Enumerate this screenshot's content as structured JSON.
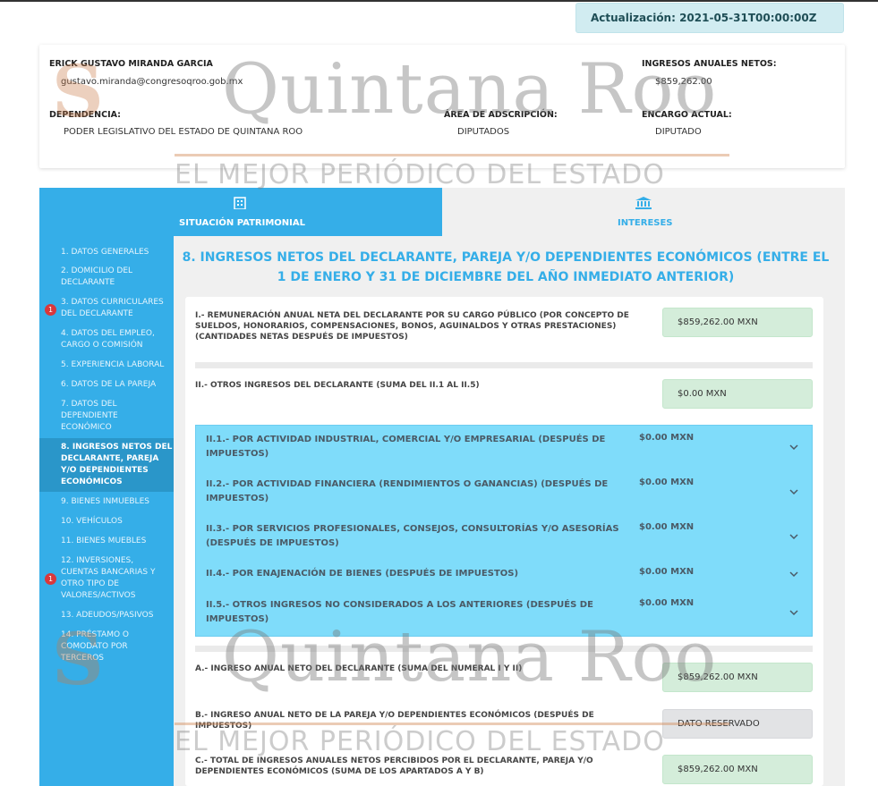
{
  "update_badge": "Actualización: 2021-05-31T00:00:00Z",
  "profile": {
    "name": "ERICK GUSTAVO MIRANDA GARCIA",
    "email": "gustavo.miranda@congresoqroo.gob.mx",
    "net_income_label": "INGRESOS ANUALES NETOS:",
    "net_income_value": "$859,262.00",
    "dependency_label": "DEPENDENCIA:",
    "dependency_value": "PODER LEGISLATIVO DEL ESTADO DE QUINTANA ROO",
    "area_label": "ÁREA DE ADSCRIPCIÓN:",
    "area_value": "DIPUTADOS",
    "position_label": "ENCARGO ACTUAL:",
    "position_value": "DIPUTADO"
  },
  "watermark": {
    "logo_text": "S",
    "big_text": "Quintana Roo",
    "sub_text": "EL MEJOR PERIÓDICO DEL ESTADO"
  },
  "tabs": {
    "patrimonial": {
      "label": "SITUACIÓN PATRIMONIAL",
      "icon": "building-icon"
    },
    "intereses": {
      "label": "INTERESES",
      "icon": "bank-icon"
    }
  },
  "sidebar": {
    "items": [
      {
        "label": "1. DATOS GENERALES"
      },
      {
        "label": "2. DOMICILIO DEL DECLARANTE"
      },
      {
        "label": "3. DATOS CURRICULARES DEL DECLARANTE",
        "badge": "1"
      },
      {
        "label": "4. DATOS DEL EMPLEO, CARGO O COMISIÓN"
      },
      {
        "label": "5. EXPERIENCIA LABORAL"
      },
      {
        "label": "6. DATOS DE LA PAREJA"
      },
      {
        "label": "7. DATOS DEL DEPENDIENTE ECONÓMICO"
      },
      {
        "label": "8. INGRESOS NETOS DEL DECLARANTE, PAREJA Y/O DEPENDIENTES ECONÓMICOS"
      },
      {
        "label": "9. BIENES INMUEBLES"
      },
      {
        "label": "10. VEHÍCULOS"
      },
      {
        "label": "11. BIENES MUEBLES"
      },
      {
        "label": "12. INVERSIONES, CUENTAS BANCARIAS Y OTRO TIPO DE VALORES/ACTIVOS",
        "badge": "1"
      },
      {
        "label": "13. ADEUDOS/PASIVOS"
      },
      {
        "label": "14. PRÉSTAMO O COMODATO POR TERCEROS"
      }
    ]
  },
  "section_title": "8. INGRESOS NETOS DEL DECLARANTE, PAREJA Y/O DEPENDIENTES ECONÓMICOS (ENTRE EL 1 DE ENERO Y 31 DE DICIEMBRE DEL AÑO INMEDIATO ANTERIOR)",
  "form": {
    "q1_label": "I.- REMUNERACIÓN ANUAL NETA DEL DECLARANTE POR SU CARGO PÚBLICO (POR CONCEPTO DE SUELDOS, HONORARIOS, COMPENSACIONES, BONOS, AGUINALDOS Y OTRAS PRESTACIONES) (CANTIDADES NETAS DESPUÉS DE IMPUESTOS)",
    "q1_value": "$859,262.00 MXN",
    "q2_label": "II.- OTROS INGRESOS DEL DECLARANTE (SUMA DEL II.1 AL II.5)",
    "q2_value": "$0.00 MXN",
    "accordion": [
      {
        "label": "II.1.- POR ACTIVIDAD INDUSTRIAL, COMERCIAL Y/O EMPRESARIAL (DESPUÉS DE IMPUESTOS)",
        "amount": "$0.00 MXN"
      },
      {
        "label": "II.2.- POR ACTIVIDAD FINANCIERA (RENDIMIENTOS O GANANCIAS) (DESPUÉS DE IMPUESTOS)",
        "amount": "$0.00 MXN"
      },
      {
        "label": "II.3.- POR SERVICIOS PROFESIONALES, CONSEJOS, CONSULTORÍAS Y/O ASESORÍAS (DESPUÉS DE IMPUESTOS)",
        "amount": "$0.00 MXN"
      },
      {
        "label": "II.4.- POR ENAJENACIÓN DE BIENES (DESPUÉS DE IMPUESTOS)",
        "amount": "$0.00 MXN"
      },
      {
        "label": "II.5.- OTROS INGRESOS NO CONSIDERADOS A LOS ANTERIORES (DESPUÉS DE IMPUESTOS)",
        "amount": "$0.00 MXN"
      }
    ],
    "qa_label": "A.- INGRESO ANUAL NETO DEL DECLARANTE (SUMA DEL NUMERAL I Y II)",
    "qa_value": "$859,262.00 MXN",
    "qb_label": "B.- INGRESO ANUAL NETO DE LA PAREJA Y/O DEPENDIENTES ECONÓMICOS (DESPUÉS DE IMPUESTOS)",
    "qb_value": "DATO RESERVADO",
    "qc_label": "C.- TOTAL DE INGRESOS ANUALES NETOS PERCIBIDOS POR EL DECLARANTE, PAREJA Y/O DEPENDIENTES ECONÓMICOS (SUMA DE LOS APARTADOS A Y B)",
    "qc_value": "$859,262.00 MXN"
  }
}
